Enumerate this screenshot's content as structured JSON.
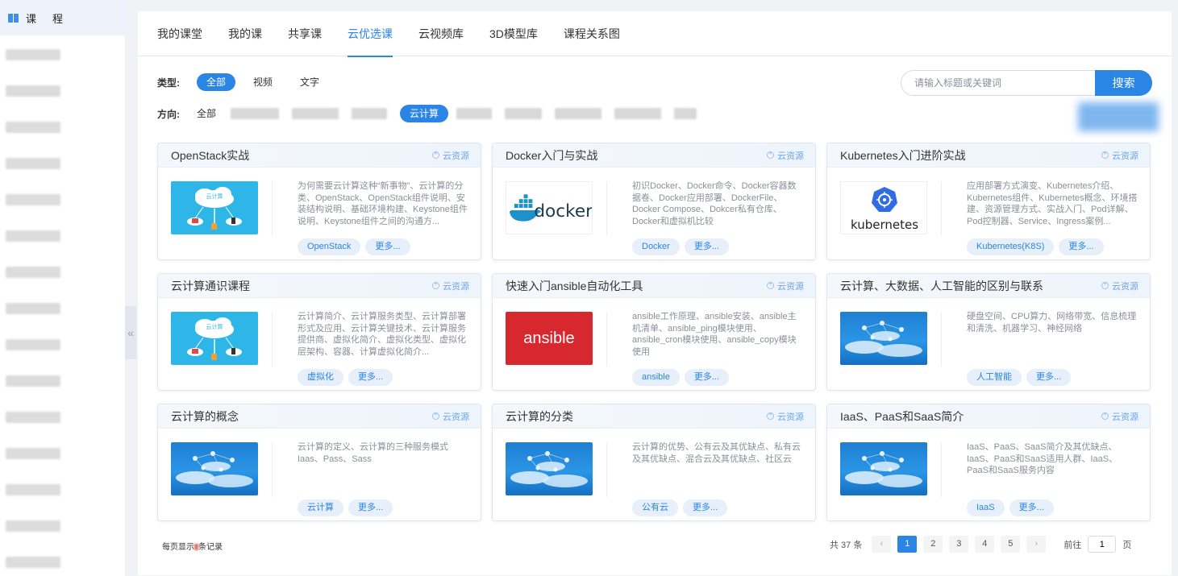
{
  "sidebar": {
    "title_1": "课",
    "title_2": "程",
    "collapse_glyph": "«"
  },
  "tabs": [
    {
      "label": "我的课堂"
    },
    {
      "label": "我的课"
    },
    {
      "label": "共享课"
    },
    {
      "label": "云优选课",
      "active": true
    },
    {
      "label": "云视频库"
    },
    {
      "label": "3D模型库"
    },
    {
      "label": "课程关系图"
    }
  ],
  "filters": {
    "type_label": "类型:",
    "type_options": [
      "全部",
      "视频",
      "文字"
    ],
    "direction_label": "方向:",
    "direction_all": "全部",
    "direction_active": "云计算"
  },
  "search": {
    "placeholder": "请输入标题或关键词",
    "button": "搜索"
  },
  "resource_label": "云资源",
  "more_label": "更多...",
  "cards": [
    {
      "title": "OpenStack实战",
      "desc": "为何需要云计算这种“新事物”、云计算的分类、OpenStack、OpenStack组件说明、安装结构说明、基础环境构建、Keystone组件说明、Keystone组件之间的沟通方...",
      "tag": "OpenStack",
      "image": "cloud"
    },
    {
      "title": "Docker入门与实战",
      "desc": "初识Docker、Docker命令、Docker容器数据卷、Docker应用部署、DockerFile、Docker Compose、Dokcer私有仓库、Docker和虚拟机比较",
      "tag": "Docker",
      "image": "docker",
      "logo_text": "docker"
    },
    {
      "title": "Kubernetes入门进阶实战",
      "desc": "应用部署方式演变、Kubernetes介绍、Kubernetes组件、Kubernetes概念、环境搭建、资源管理方式、实战入门、Pod详解、Pod控制器、Service、Ingress案例...",
      "tag": "Kubernetes(K8S)",
      "image": "k8s",
      "logo_text": "kubernetes"
    },
    {
      "title": "云计算通识课程",
      "desc": "云计算简介、云计算服务类型、云计算部署形式及应用、云计算关键技术、云计算服务提供商、虚拟化简介、虚拟化类型、虚拟化层架构、容器、计算虚拟化简介...",
      "tag": "虚拟化",
      "image": "cloud"
    },
    {
      "title": "快速入门ansible自动化工具",
      "desc": "ansible工作原理、ansible安装、ansible主机清单、ansible_ping模块使用、ansible_cron模块使用、ansible_copy模块使用",
      "tag": "ansible",
      "image": "ansible",
      "logo_text": "ansible"
    },
    {
      "title": "云计算、大数据、人工智能的区别与联系",
      "desc": "硬盘空间、CPU算力、网络带宽、信息梳理和清洗、机器学习、神经网络",
      "tag": "人工智能",
      "image": "net"
    },
    {
      "title": "云计算的概念",
      "desc": "云计算的定义、云计算的三种服务模式Iaas、Pass、Sass",
      "tag": "云计算",
      "image": "net"
    },
    {
      "title": "云计算的分类",
      "desc": "云计算的优势、公有云及其优缺点、私有云及其优缺点、混合云及其优缺点、社区云",
      "tag": "公有云",
      "image": "net"
    },
    {
      "title": "IaaS、PaaS和SaaS简介",
      "desc": "IaaS、PaaS、SaaS简介及其优缺点、IaaS、PaaS和SaaS适用人群、IaaS、PaaS和SaaS服务内容",
      "tag": "IaaS",
      "image": "net"
    }
  ],
  "cloud_image_label": "云计算",
  "pagination": {
    "per_page_prefix": "每页显示",
    "per_page_suffix": "条记录",
    "total": "共 37 条",
    "prev": "‹",
    "next": "›",
    "pages": [
      "1",
      "2",
      "3",
      "4",
      "5"
    ],
    "current": "1",
    "goto_prefix": "前往",
    "goto_value": "1",
    "goto_suffix": "页"
  },
  "colors": {
    "accent": "#2b85e4",
    "tag_bg": "#e6effa",
    "ansible_red": "#d7282f",
    "cloud_blue": "#2fb6e9"
  }
}
